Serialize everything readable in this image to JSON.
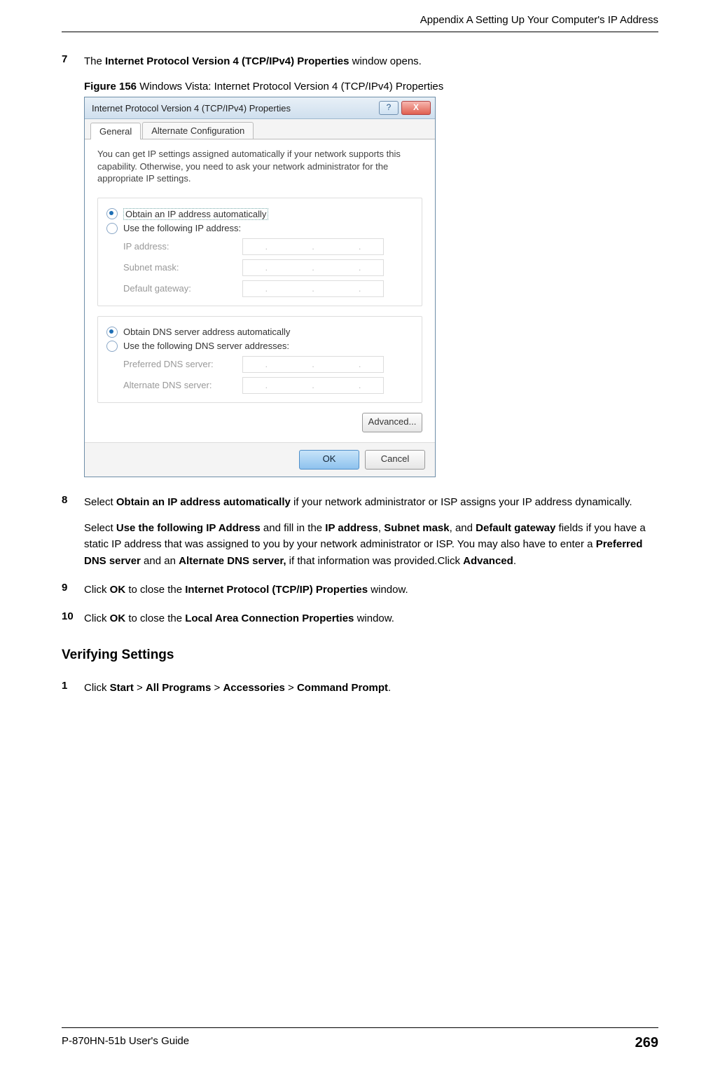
{
  "header": {
    "text": "Appendix A Setting Up Your Computer's IP Address"
  },
  "steps": {
    "s7": {
      "num": "7",
      "t1": "The ",
      "b1": "Internet Protocol Version 4 (TCP/IPv4) Properties",
      "t2": " window opens."
    },
    "figcap": {
      "label": "Figure 156",
      "text": "   Windows Vista: Internet Protocol Version 4 (TCP/IPv4) Properties"
    },
    "s8": {
      "num": "8",
      "p1a": "Select ",
      "p1b": "Obtain an IP address automatically",
      "p1c": " if your network administrator or ISP assigns your IP address dynamically.",
      "p2a": "Select ",
      "p2b": "Use the following IP Address",
      "p2c": " and fill in the ",
      "p2d": "IP address",
      "p2e": ", ",
      "p2f": "Subnet mask",
      "p2g": ", and ",
      "p2h": "Default gateway",
      "p2i": " fields if you have a static IP address that was assigned to you by your network administrator or ISP. You may also have to enter a ",
      "p2j": "Preferred DNS server",
      "p2k": " and an ",
      "p2l": "Alternate DNS server,",
      "p2m": " if that information was provided.Click ",
      "p2n": "Advanced",
      "p2o": "."
    },
    "s9": {
      "num": "9",
      "a": "Click ",
      "b": "OK",
      "c": " to close the ",
      "d": "Internet Protocol (TCP/IP) Properties",
      "e": " window."
    },
    "s10": {
      "num": "10",
      "a": "Click ",
      "b": "OK",
      "c": " to close the ",
      "d": "Local Area Connection Properties",
      "e": " window."
    }
  },
  "verifying": {
    "title": "Verifying Settings",
    "s1": {
      "num": "1",
      "a": "Click ",
      "b": "Start",
      "c": " > ",
      "d": "All Programs",
      "e": " > ",
      "f": "Accessories",
      "g": " > ",
      "h": "Command Prompt",
      "i": "."
    }
  },
  "dialog": {
    "title": "Internet Protocol Version 4 (TCP/IPv4) Properties",
    "help": "?",
    "close": "X",
    "tabs": {
      "general": "General",
      "alt": "Alternate Configuration"
    },
    "desc": "You can get IP settings assigned automatically if your network supports this capability. Otherwise, you need to ask your network administrator for the appropriate IP settings.",
    "r1": "Obtain an IP address automatically",
    "r2": "Use the following IP address:",
    "ip": "IP address:",
    "subnet": "Subnet mask:",
    "gw": "Default gateway:",
    "r3": "Obtain DNS server address automatically",
    "r4": "Use the following DNS server addresses:",
    "pdns": "Preferred DNS server:",
    "adns": "Alternate DNS server:",
    "adv": "Advanced...",
    "ok": "OK",
    "cancel": "Cancel"
  },
  "footer": {
    "guide": "P-870HN-51b User's Guide",
    "page": "269"
  }
}
